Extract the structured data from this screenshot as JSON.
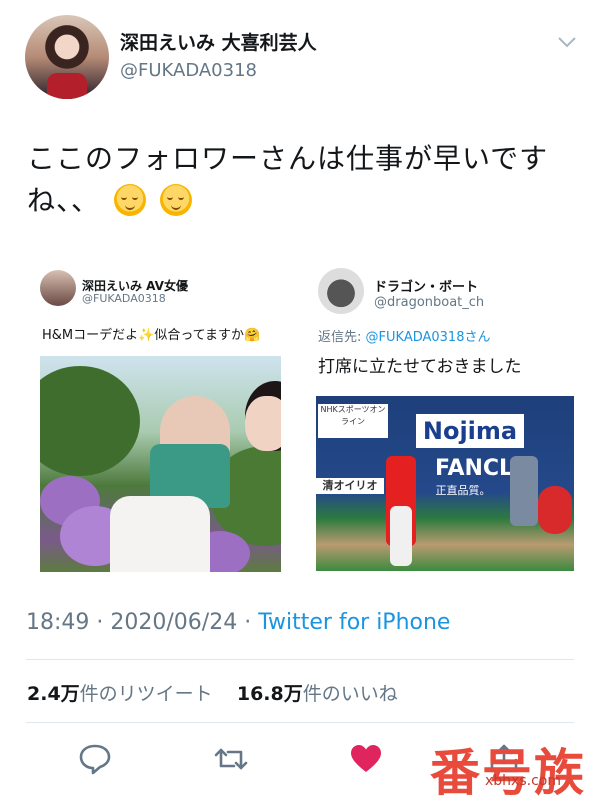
{
  "author": {
    "display_name": "深田えいみ 大喜利芸人",
    "handle": "@FUKADA0318"
  },
  "tweet": {
    "text": "ここのフォロワーさんは仕事が早いですね、、"
  },
  "embedded_left": {
    "display_name": "深田えいみ AV女優",
    "handle": "@FUKADA0318",
    "text": "H&Mコーデだよ✨似合ってますか🤗"
  },
  "embedded_right": {
    "display_name": "ドラゴン・ボート",
    "handle": "@dragonboat_ch",
    "reply_label": "返信先:",
    "reply_handle": "@FUKADA0318さん",
    "text": "打席に立たせておきました",
    "ad_top": "Nojima",
    "ad_bottom": "FANCL",
    "ad_sub": "正直品質。",
    "ad_left": "清オイリオ",
    "scoreboard_text": "NHKスポーツオンライン"
  },
  "meta": {
    "time": "18:49",
    "separator": "·",
    "date": "2020/06/24",
    "source": "Twitter for iPhone"
  },
  "stats": {
    "retweets_value": "2.4万",
    "retweets_label": "件のリツイート",
    "likes_value": "16.8万",
    "likes_label": "件のいいね"
  },
  "icons": {
    "reply": "speech-bubble-icon",
    "retweet": "retweet-icon",
    "like": "heart-icon",
    "share": "share-icon",
    "more": "chevron-down-icon"
  },
  "colors": {
    "link": "#1b95e0",
    "secondary": "#657786",
    "like": "#e0245e",
    "watermark": "#e84a3c"
  },
  "watermark": {
    "title": "番号族",
    "url": "xbhxs.com"
  }
}
